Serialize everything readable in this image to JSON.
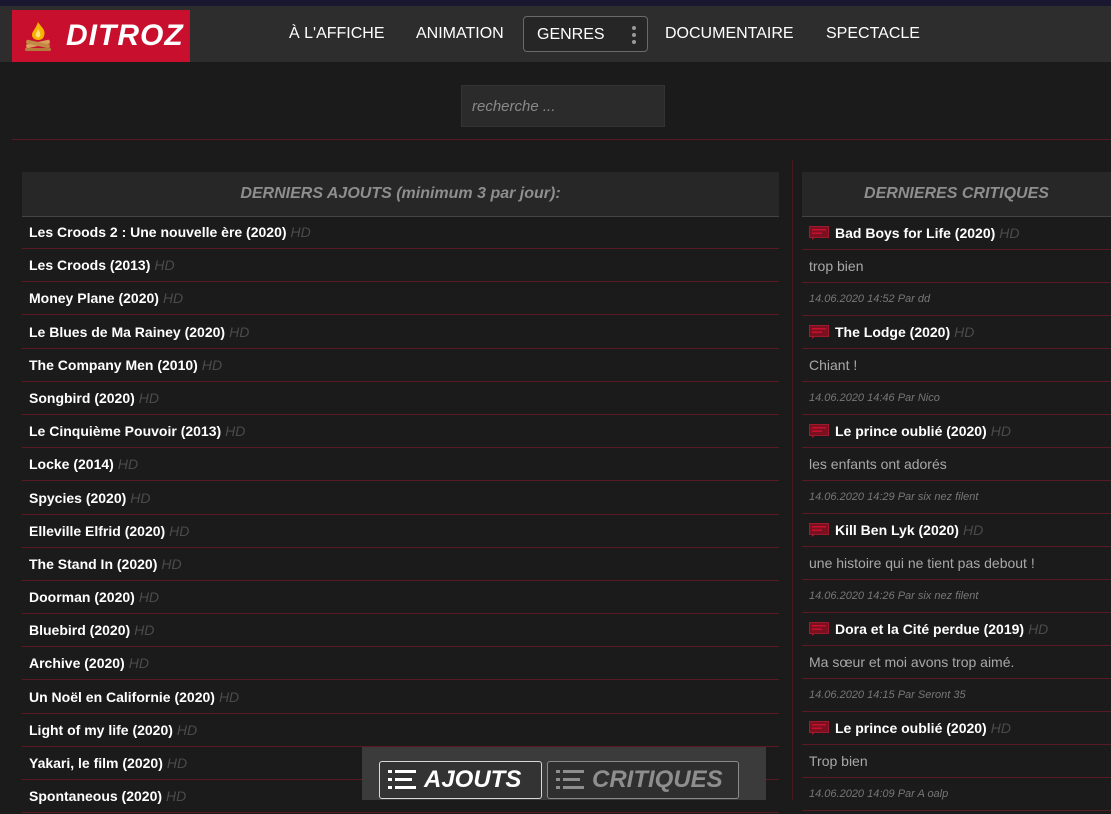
{
  "brand": {
    "name": "DITROZ",
    "accent": "#c8102e"
  },
  "nav": {
    "items": [
      {
        "label": "À L'AFFICHE"
      },
      {
        "label": "ANIMATION"
      },
      {
        "label": "GENRES"
      },
      {
        "label": "DOCUMENTAIRE"
      },
      {
        "label": "SPECTACLE"
      }
    ]
  },
  "search": {
    "placeholder": "recherche ..."
  },
  "latest": {
    "heading": "DERNIERS AJOUTS (minimum 3 par jour):",
    "hd_badge": "HD",
    "items": [
      {
        "title": "Les Croods 2 : Une nouvelle ère (2020)"
      },
      {
        "title": "Les Croods (2013)"
      },
      {
        "title": "Money Plane (2020)"
      },
      {
        "title": "Le Blues de Ma Rainey (2020)"
      },
      {
        "title": "The Company Men (2010)"
      },
      {
        "title": "Songbird (2020)"
      },
      {
        "title": "Le Cinquième Pouvoir (2013)"
      },
      {
        "title": "Locke (2014)"
      },
      {
        "title": "Spycies (2020)"
      },
      {
        "title": "Elleville Elfrid (2020)"
      },
      {
        "title": "The Stand In (2020)"
      },
      {
        "title": "Doorman (2020)"
      },
      {
        "title": "Bluebird (2020)"
      },
      {
        "title": "Archive (2020)"
      },
      {
        "title": "Un Noël en Californie (2020)"
      },
      {
        "title": "Light of my life (2020)"
      },
      {
        "title": "Yakari, le film (2020)"
      },
      {
        "title": "Spontaneous (2020)"
      }
    ]
  },
  "reviews": {
    "heading_part1": "DERNIERES ",
    "heading_part2": "CRITIQUES",
    "hd_badge": "HD",
    "items": [
      {
        "title": "Bad Boys for Life (2020)",
        "text": "trop bien",
        "meta": "14.06.2020 14:52 Par dd"
      },
      {
        "title": "The Lodge (2020)",
        "text": "Chiant !",
        "meta": "14.06.2020 14:46 Par Nico"
      },
      {
        "title": "Le prince oublié (2020)",
        "text": "les enfants ont adorés",
        "meta": "14.06.2020 14:29 Par six nez filent"
      },
      {
        "title": "Kill Ben Lyk (2020)",
        "text": "une histoire qui ne tient pas debout !",
        "meta": "14.06.2020 14:26 Par six nez filent"
      },
      {
        "title": "Dora et la Cité perdue (2019)",
        "text": "Ma sœur et moi avons trop aimé.",
        "meta": "14.06.2020 14:15 Par Seront 35"
      },
      {
        "title": "Le prince oublié (2020)",
        "text": "Trop bien",
        "meta": "14.06.2020 14:09 Par A oalp"
      }
    ]
  },
  "toggle": {
    "ajouts_label": "AJOUTS",
    "critiques_label": "CRITIQUES"
  },
  "icons": {
    "logo": "campfire-icon",
    "review": "comment-icon",
    "menu": "list-icon",
    "more": "kebab-icon"
  }
}
